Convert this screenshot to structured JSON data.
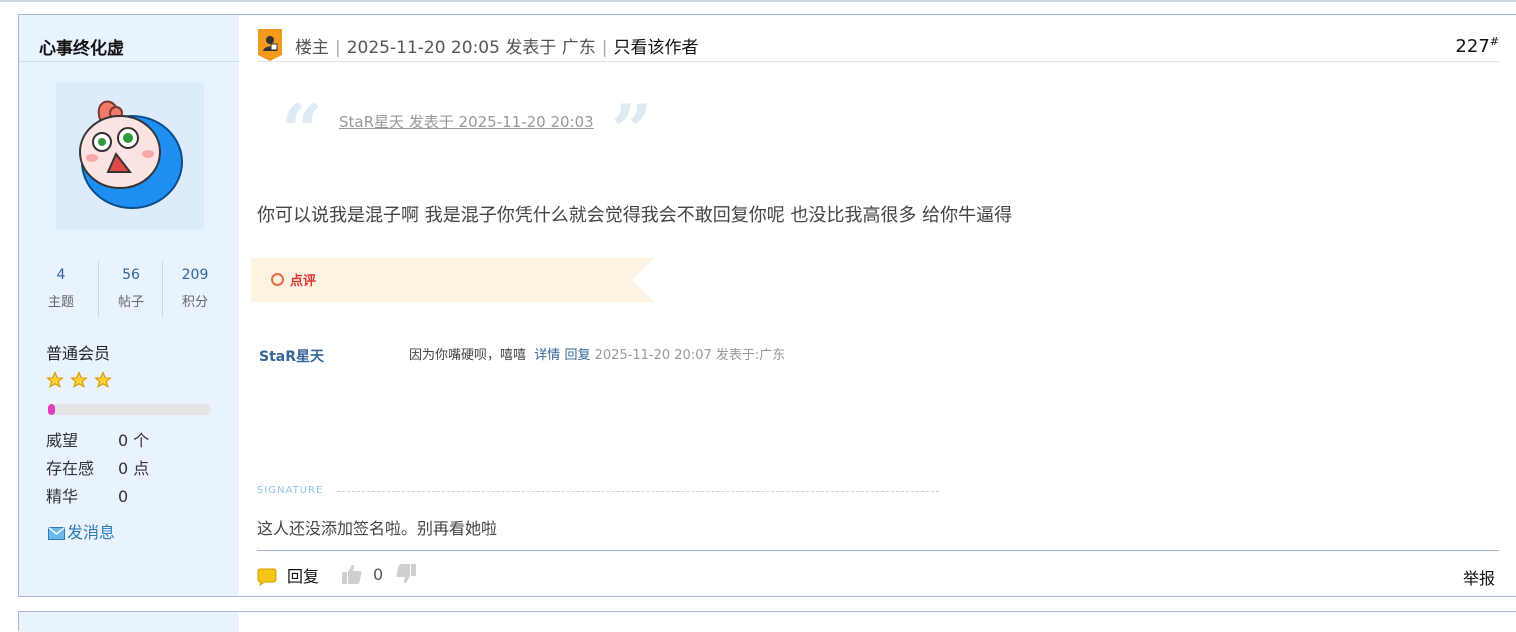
{
  "user": {
    "name": "心事终化虚",
    "stats": [
      {
        "value": "4",
        "label": "主题"
      },
      {
        "value": "56",
        "label": "帖子"
      },
      {
        "value": "209",
        "label": "积分"
      }
    ],
    "group": "普通会员",
    "star_count": 3,
    "progress_fraction": 0.04,
    "info": [
      {
        "key": "威望",
        "value": "0 个"
      },
      {
        "key": "存在感",
        "value": "0 点"
      },
      {
        "key": "精华",
        "value": "0"
      }
    ],
    "message_label": "发消息"
  },
  "post": {
    "role": "楼主",
    "datetime": "2025-11-20 20:05",
    "posted_at": "发表于 广东",
    "only_author": "只看该作者",
    "floor": "227",
    "floor_mark": "#",
    "quote": "StaR星天 发表于 2025-11-20 20:03",
    "content": "你可以说我是混子啊  我是混子你凭什么就会觉得我会不敢回复你呢  也没比我高很多 给你牛逼得"
  },
  "comments": {
    "label": "点评",
    "items": [
      {
        "user": "StaR星天",
        "text": "因为你嘴硬呗，嘻嘻",
        "detail": "详情",
        "reply": "回复",
        "meta": "2025-11-20 20:07 发表于:广东"
      }
    ]
  },
  "signature": {
    "label": "SIGNATURE",
    "text": "这人还没添加签名啦。别再看她啦"
  },
  "footer": {
    "reply": "回复",
    "likes": "0",
    "report": "举报"
  },
  "colors": {
    "sidebar_bg": "#e8f3fd",
    "link": "#336699",
    "comment_banner": "#fdf3e0",
    "comment_label": "#dd3333"
  }
}
